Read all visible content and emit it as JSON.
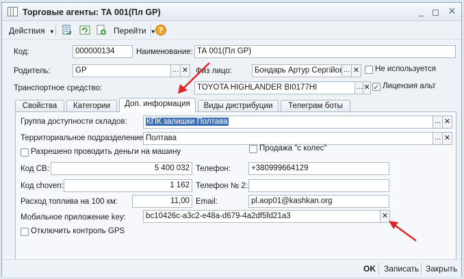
{
  "window": {
    "title": "Торговые агенты: ТА 001(Пл GP)"
  },
  "toolbar": {
    "actions_label": "Действия",
    "goto_label": "Перейти",
    "help_label": "?"
  },
  "header": {
    "code_label": "Код:",
    "code_value": "000000134",
    "name_label": "Наименование:",
    "name_value": "ТА 001(Пл GP)",
    "parent_label": "Родитель:",
    "parent_value": "GP",
    "person_label": "Физ лицо:",
    "person_value": "Бондарь Артур Сергійови",
    "not_used_label": "Не используется",
    "not_used_checked": false,
    "vehicle_label": "Транспортное средство:",
    "vehicle_value": "TOYOTA HIGHLANDER BI0177HI",
    "license_label": "Лицензия альт",
    "license_checked": true
  },
  "tabs": [
    {
      "label": "Свойства",
      "active": false
    },
    {
      "label": "Категории",
      "active": false
    },
    {
      "label": "Доп. информация",
      "active": true
    },
    {
      "label": "Виды дистрибуции",
      "active": false
    },
    {
      "label": "Телеграм боты",
      "active": false
    }
  ],
  "panel": {
    "warehouse_group_label": "Группа доступности складов:",
    "warehouse_group_value": "КПК залишки Полтава",
    "territorial_label": "Территориальное подразделение:",
    "territorial_value": "Полтава",
    "money_car_label": "Разрешено проводить деньги на машину",
    "money_car_checked": false,
    "wheels_label": "Продажа \"с колес\"",
    "wheels_checked": false,
    "code_sv_label": "Код СВ:",
    "code_sv_value": "5 400 032",
    "code_choven_label": "Код choven:",
    "code_choven_value": "1 162",
    "fuel_label": "Расход топлива на 100 км:",
    "fuel_value": "11,00",
    "phone_label": "Телефон:",
    "phone_value": "+380999664129",
    "phone2_label": "Телефон № 2:",
    "phone2_value": "",
    "email_label": "Email:",
    "email_value": "pl.aop01@kashkan.org",
    "mobile_key_label": "Мобильное приложение key:",
    "mobile_key_value": "bc10426c-a3c2-e48a-d679-4a2df5fd21a3",
    "gps_label": "Отключить контроль GPS",
    "gps_checked": false
  },
  "footer": {
    "ok_label": "OK",
    "save_label": "Записать",
    "close_label": "Закрыть"
  },
  "colors": {
    "accent_red": "#e02424",
    "selection": "#3d6fb6"
  }
}
